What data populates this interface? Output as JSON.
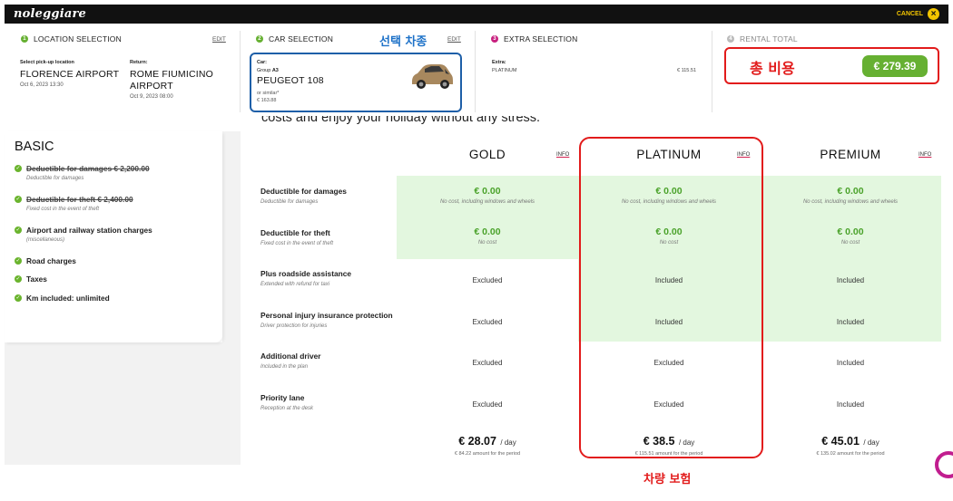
{
  "header": {
    "logo": "noleggiare",
    "cancel_label": "CANCEL",
    "cancel_icon": "×"
  },
  "steps": {
    "location": {
      "num": "1",
      "title": "LOCATION SELECTION",
      "edit": "EDIT",
      "pickup_label": "Select pick-up location",
      "pickup_value": "FLORENCE AIRPORT",
      "pickup_date": "Oct 6, 2023 13:30",
      "return_label": "Return:",
      "return_value_line1": "ROME FIUMICINO",
      "return_value_line2": "AIRPORT",
      "return_date": "Oct 9, 2023 08:00"
    },
    "car": {
      "num": "2",
      "title": "CAR SELECTION",
      "edit": "EDIT",
      "car_label": "Car:",
      "group_prefix": "Group",
      "group_value": "A3",
      "model": "PEUGEOT 108",
      "similar": "or similar*",
      "price": "€ 163.88"
    },
    "extra": {
      "num": "3",
      "title": "EXTRA SELECTION",
      "extra_label": "Extra:",
      "extra_value": "PLATINUM",
      "extra_price": "€ 115.51"
    },
    "total": {
      "num": "4",
      "title": "RENTAL TOTAL",
      "amount": "€ 279.39"
    }
  },
  "basic": {
    "title": "BASIC",
    "items": [
      {
        "name": "Deductible for damages € 2,200.00",
        "sub": "Deductible for damages",
        "strike": true
      },
      {
        "name": "Deductible for theft € 2,400.00",
        "sub": "Fixed cost in the event of theft",
        "strike": true
      },
      {
        "name": "Airport and railway station charges",
        "sub": "(miscellaneous)",
        "strike": false
      },
      {
        "name": "Road charges",
        "sub": "",
        "strike": false
      },
      {
        "name": "Taxes",
        "sub": "",
        "strike": false
      },
      {
        "name": "Km included: unlimited",
        "sub": "",
        "strike": false
      }
    ]
  },
  "intro_text": "costs and enjoy your holiday without any stress.",
  "plans": {
    "info_label": "INFO",
    "columns": [
      "GOLD",
      "PLATINUM",
      "PREMIUM"
    ]
  },
  "rows": [
    {
      "name": "Deductible for damages",
      "sub": "Deductible for damages",
      "cells": [
        {
          "price": "€ 0.00",
          "sub": "No cost, including windows and wheels"
        },
        {
          "price": "€ 0.00",
          "sub": "No cost, including windows and wheels"
        },
        {
          "price": "€ 0.00",
          "sub": "No cost, including windows and wheels"
        }
      ]
    },
    {
      "name": "Deductible for theft",
      "sub": "Fixed cost in the event of theft",
      "cells": [
        {
          "price": "€ 0.00",
          "sub": "No cost"
        },
        {
          "price": "€ 0.00",
          "sub": "No cost"
        },
        {
          "price": "€ 0.00",
          "sub": "No cost"
        }
      ]
    },
    {
      "name": "Plus roadside assistance",
      "sub": "Extended with refund for taxi",
      "cells": [
        {
          "text": "Excluded"
        },
        {
          "text": "Included"
        },
        {
          "text": "Included"
        }
      ]
    },
    {
      "name": "Personal injury insurance protection",
      "sub": "Driver protection for injuries",
      "cells": [
        {
          "text": "Excluded"
        },
        {
          "text": "Included"
        },
        {
          "text": "Included"
        }
      ]
    },
    {
      "name": "Additional driver",
      "sub": "Included in the plan",
      "cells": [
        {
          "text": "Excluded"
        },
        {
          "text": "Excluded"
        },
        {
          "text": "Included"
        }
      ]
    },
    {
      "name": "Priority lane",
      "sub": "Reception at the desk",
      "cells": [
        {
          "text": "Excluded"
        },
        {
          "text": "Excluded"
        },
        {
          "text": "Included"
        }
      ]
    }
  ],
  "footer": [
    {
      "price": "€ 28.07",
      "per": "/ day",
      "sub": "€ 84.22 amount for the period"
    },
    {
      "price": "€ 38.5",
      "per": "/ day",
      "sub": "€ 115.51 amount for the period"
    },
    {
      "price": "€ 45.01",
      "per": "/ day",
      "sub": "€ 135.02 amount for the period"
    }
  ],
  "annotations": {
    "car_label": "선택 차종",
    "total_label": "총 비용",
    "insurance_label": "차량 보험"
  },
  "colors": {
    "accent_green": "#66b032",
    "cell_green": "#e3f7df",
    "annotation_red": "#e21b1b",
    "annotation_blue": "#1e5fa8",
    "cancel_yellow": "#f2c400"
  }
}
